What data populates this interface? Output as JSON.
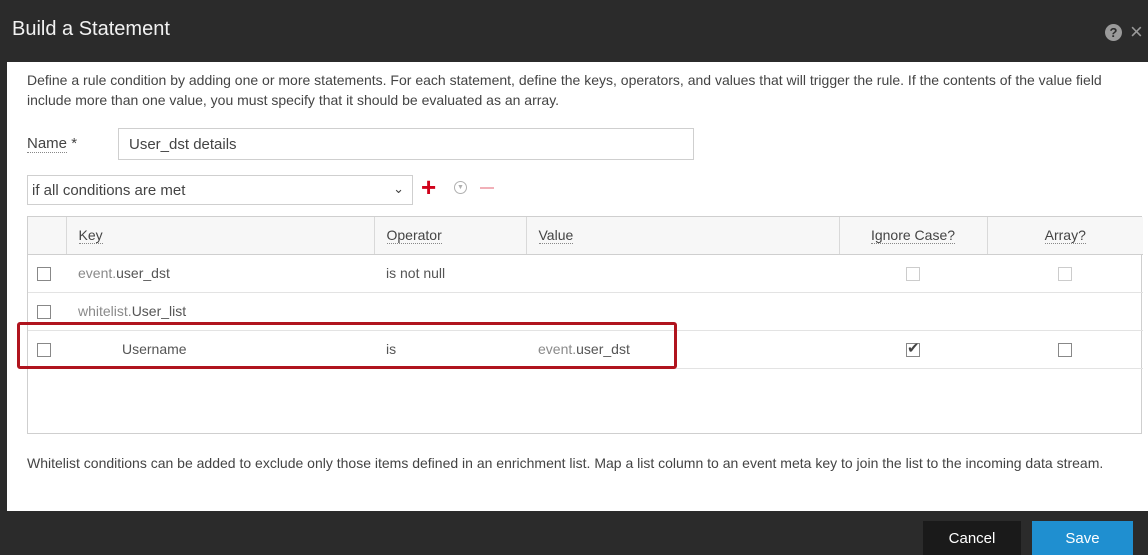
{
  "dialog": {
    "title": "Build a Statement",
    "help_icon": "question-circle-icon",
    "close_icon": "close-icon"
  },
  "description": "Define a rule condition by adding one or more statements. For each statement, define the keys, operators, and values that will trigger the rule. If the contents of the value field include more than one value, you must specify that it should be evaluated as an array.",
  "name_field": {
    "label": "Name",
    "required_mark": "*",
    "value": "User_dst details"
  },
  "condition_select": {
    "selected": "if all conditions are met"
  },
  "table": {
    "columns": [
      "Key",
      "Operator",
      "Value",
      "Ignore Case?",
      "Array?"
    ],
    "rows": [
      {
        "key_prefix": "event.",
        "key_name": "user_dst",
        "operator": "is not null",
        "value_prefix": "",
        "value_name": "",
        "ignore_case": false,
        "array": false,
        "ignore_case_disabled": true,
        "array_disabled": true
      },
      {
        "key_prefix": "whitelist.",
        "key_name": "User_list",
        "operator": "",
        "value_prefix": "",
        "value_name": "",
        "ignore_case": null,
        "array": null
      },
      {
        "key_prefix": "",
        "key_name": "Username",
        "operator": "is",
        "value_prefix": "event.",
        "value_name": "user_dst",
        "ignore_case": true,
        "array": false
      }
    ]
  },
  "footer_note": "Whitelist conditions can be added to exclude only those items defined in an enrichment list. Map a list column to an event meta key to join the list to the incoming data stream.",
  "buttons": {
    "cancel": "Cancel",
    "save": "Save"
  },
  "colors": {
    "header_bg": "#2b2b2b",
    "accent_add": "#d0021b",
    "save_button": "#1f8fd0",
    "highlight_border": "#b0141e"
  }
}
